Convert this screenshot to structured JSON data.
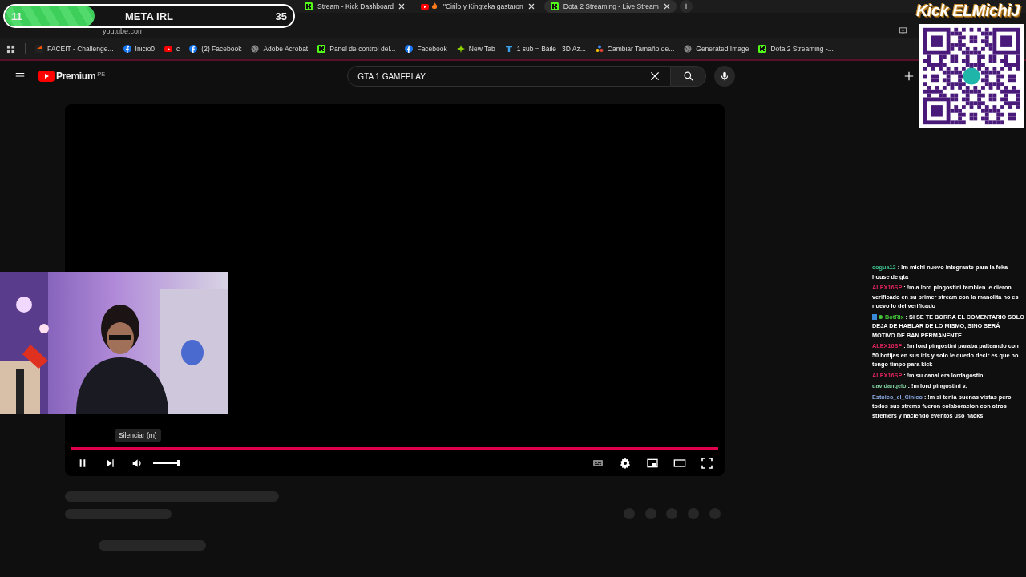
{
  "meta_goal": {
    "current": "11",
    "title": "META IRL",
    "target": "35",
    "level": 0.31
  },
  "browser": {
    "tabs": [
      {
        "title": "Stream - Kick Dashboard",
        "kind": "kick",
        "selected": false
      },
      {
        "title": "\"Cirilo y Kingteka gastaron",
        "kind": "youtube-fire",
        "selected": false
      },
      {
        "title": "Dota 2 Streaming - Live Stream",
        "kind": "kick",
        "selected": true
      }
    ],
    "new_tab": "+",
    "address": "youtube.com",
    "bookmarks": [
      {
        "label": "FACEIT - Challenge...",
        "kind": "faceit"
      },
      {
        "label": "Inicio0",
        "kind": "facebook"
      },
      {
        "label": "c",
        "kind": "youtube"
      },
      {
        "label": "(2) Facebook",
        "kind": "facebook"
      },
      {
        "label": "Adobe Acrobat",
        "kind": "globe"
      },
      {
        "label": "Panel de control del...",
        "kind": "kick"
      },
      {
        "label": "Facebook",
        "kind": "facebook"
      },
      {
        "label": "New Tab",
        "kind": "star"
      },
      {
        "label": "1 sub = Baile | 3D Az...",
        "kind": "letter"
      },
      {
        "label": "Cambiar Tamaño de...",
        "kind": "dots"
      },
      {
        "label": "Generated Image",
        "kind": "globe"
      },
      {
        "label": "Dota 2 Streaming -...",
        "kind": "kick"
      }
    ]
  },
  "youtube": {
    "logo_text": "Premium",
    "region": "PE",
    "search_value": "GTA 1 GAMEPLAY"
  },
  "player": {
    "playing": true,
    "progress": {
      "level": 1
    },
    "volume": {
      "level": 1
    },
    "tooltip": "Silenciar (m)"
  },
  "kick_banner": "Kick ELMichiJ",
  "chat": [
    {
      "kind": "user",
      "user": "cogua12",
      "color": "#3fbf8f",
      "text": ": !m michi nuevo integrante para la feka house de gta"
    },
    {
      "kind": "user",
      "user": "ALEX16SP",
      "color": "#e0245e",
      "text": ": !m a lord pingostini tambien le dieron verificado en su primer stream con la manolita no es nuevo lo del verificado"
    },
    {
      "kind": "bot",
      "user": "BotRix",
      "color": "#45c83a",
      "text": ": SI SE TE BORRA EL COMENTARIO SOLO DEJA DE HABLAR DE LO MISMO, SINO SERÁ MOTIVO DE BAN PERMANENTE"
    },
    {
      "kind": "user",
      "user": "ALEX16SP",
      "color": "#e0245e",
      "text": ": !m lord pingostini paraba palteando con 50 botijas en sus irls y solo le quedo decir es que no tengo timpo para kick"
    },
    {
      "kind": "user",
      "user": "ALEX16SP",
      "color": "#e0245e",
      "text": ": !m su canal era lordagostini"
    },
    {
      "kind": "user",
      "user": "davidangelo",
      "color": "#7fd0a0",
      "text": ": !m lord pingostini v."
    },
    {
      "kind": "user",
      "user": "Estoico_el_Cinico",
      "color": "#8aa8e0",
      "text": ": !m si tenia buenas vistas pero todos sus strems fueron colaboracion con otros stremers y haciendo eventos uso hacks"
    }
  ]
}
